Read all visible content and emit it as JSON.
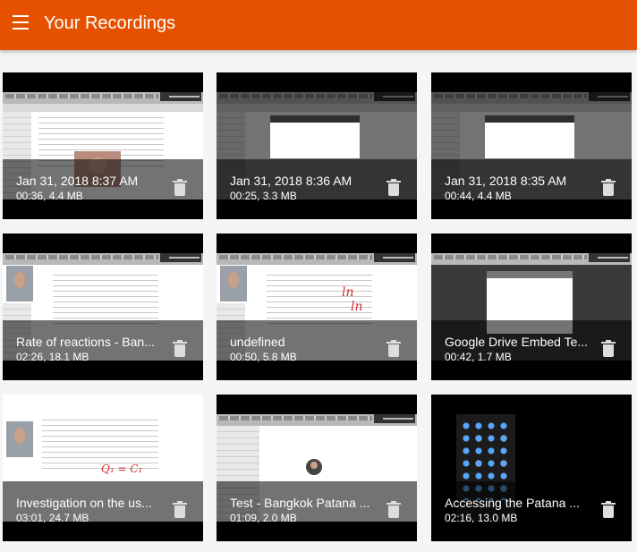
{
  "appbar": {
    "title": "Your Recordings",
    "menu_icon": "menu-icon",
    "color": "#e65100"
  },
  "recordings": [
    {
      "title": "Jan 31, 2018 8:37 AM",
      "meta": "00:36, 4.4 MB"
    },
    {
      "title": "Jan 31, 2018 8:36 AM",
      "meta": "00:25, 3.3 MB"
    },
    {
      "title": "Jan 31, 2018 8:35 AM",
      "meta": "00:44, 4.4 MB"
    },
    {
      "title": "Rate of reactions - Ban...",
      "meta": "02:26, 18.1 MB"
    },
    {
      "title": "undefined",
      "meta": "00:50, 5.8 MB"
    },
    {
      "title": "Google Drive Embed Te...",
      "meta": "00:42, 1.7 MB"
    },
    {
      "title": "Investigation on the us...",
      "meta": "03:01, 24.7 MB"
    },
    {
      "title": "Test - Bangkok Patana ...",
      "meta": "01:09, 2.0 MB"
    },
    {
      "title": "Accessing the Patana ...",
      "meta": "02:16, 13.0 MB"
    }
  ],
  "delete_icon": "trash-icon"
}
